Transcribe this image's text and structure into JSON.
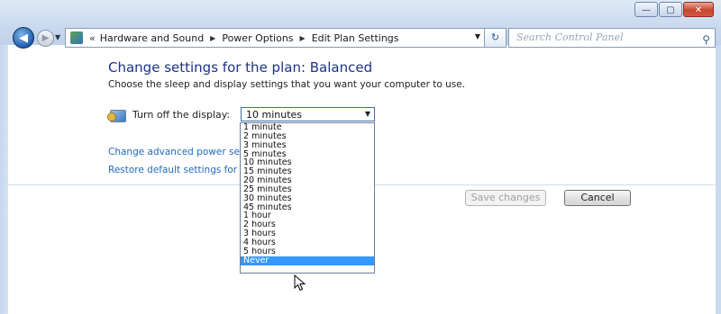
{
  "window": {
    "controls": {
      "minimize": "—",
      "maximize": "▢",
      "close": "✕"
    }
  },
  "nav": {
    "back_glyph": "◀",
    "forward_glyph": "▶",
    "overflow_glyph": "«",
    "breadcrumbs": [
      "Hardware and Sound",
      "Power Options",
      "Edit Plan Settings"
    ],
    "refresh_glyph": "↻",
    "search_placeholder": "Search Control Panel"
  },
  "icons": {
    "back": "back-arrow-icon",
    "forward": "forward-arrow-icon",
    "control_panel": "control-panel-icon",
    "refresh": "refresh-icon",
    "search": "search-icon",
    "display": "display-icon",
    "cursor": "mouse-pointer-icon"
  },
  "main": {
    "title": "Change settings for the plan: Balanced",
    "subtitle": "Choose the sleep and display settings that you want your computer to use.",
    "display_label": "Turn off the display:",
    "display_value": "10 minutes",
    "link_advanced": "Change advanced power settings",
    "link_restore": "Restore default settings for this plan",
    "save_button": "Save changes",
    "cancel_button": "Cancel"
  },
  "dropdown": {
    "options": [
      "1 minute",
      "2 minutes",
      "3 minutes",
      "5 minutes",
      "10 minutes",
      "15 minutes",
      "20 minutes",
      "25 minutes",
      "30 minutes",
      "45 minutes",
      "1 hour",
      "2 hours",
      "3 hours",
      "4 hours",
      "5 hours",
      "Never"
    ],
    "highlighted": "Never"
  },
  "colors": {
    "title": "#1e3287",
    "link": "#1e6abd",
    "highlight": "#3399ff"
  }
}
